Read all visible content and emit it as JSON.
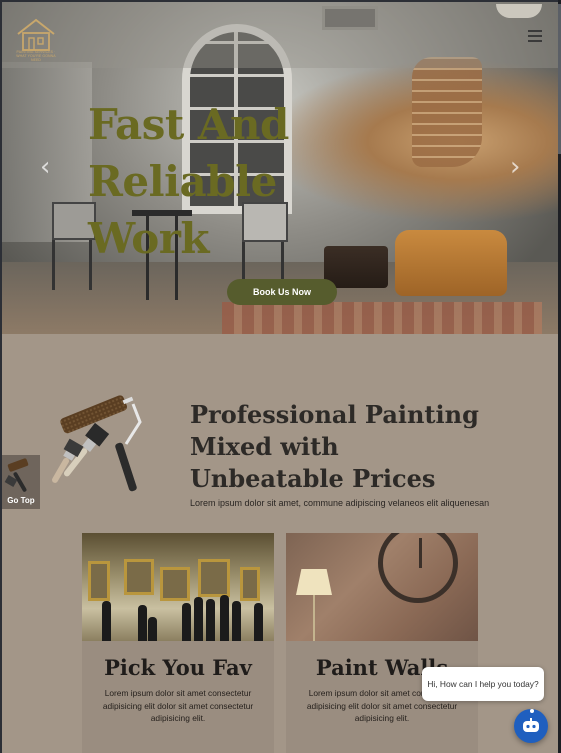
{
  "header": {
    "logo_text": "PAINTING SERVICES · WHAT YOU'RE GONNA NEED",
    "menu_icon": "hamburger-icon"
  },
  "hero": {
    "title": "Fast And Reliable Work",
    "prev_icon": "chevron-left-icon",
    "next_icon": "chevron-right-icon",
    "cta_label": "Book Us Now",
    "title_color": "#6a6a22",
    "cta_color": "#565c2d"
  },
  "intro": {
    "title": "Professional Painting Mixed with Unbeatable Prices",
    "subtitle": "Lorem ipsum dolor sit amet, commune adipiscing velaneos elit aliquenesan"
  },
  "go_top": {
    "label": "Go Top"
  },
  "cards": [
    {
      "title": "Pick You Fav",
      "text": "Lorem ipsum dolor sit amet consectetur adipisicing elit dolor sit amet consectetur adipisicing elit."
    },
    {
      "title": "Paint Walls",
      "text": "Lorem ipsum dolor sit amet consectetur adipisicing elit dolor sit amet consectetur adipisicing elit."
    }
  ],
  "chat": {
    "message": "Hi, How can I help you today?",
    "button_icon": "chatbot-icon",
    "accent": "#1f5fbf"
  },
  "colors": {
    "page_background": "#a39688",
    "card_background": "#9a8d80"
  }
}
